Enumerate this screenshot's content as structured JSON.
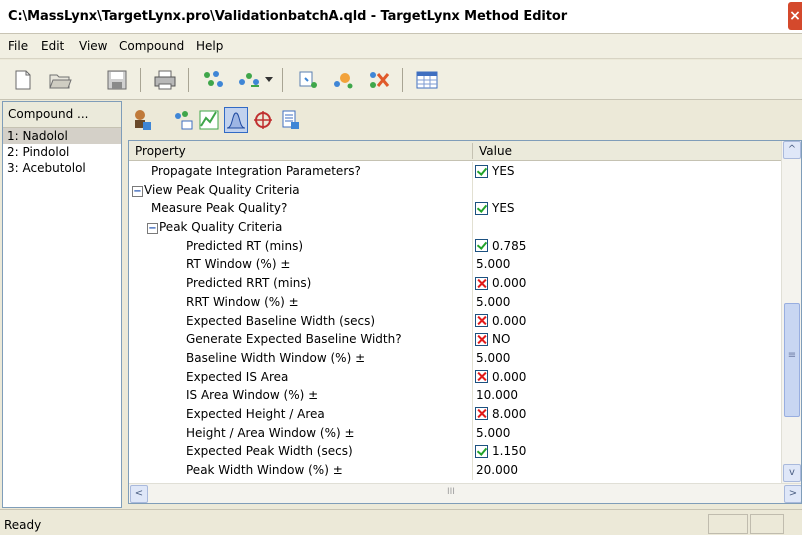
{
  "window": {
    "title": "C:\\MassLynx\\TargetLynx.pro\\ValidationbatchA.qld - TargetLynx Method Editor",
    "close_label": "×"
  },
  "menu": {
    "items": [
      "File",
      "Edit",
      "View",
      "Compound",
      "Help"
    ]
  },
  "toolbar": {
    "icons": [
      "new-file-icon",
      "open-folder-icon",
      "save-icon",
      "print-icon",
      "add-compound-icon",
      "insert-compound-icon",
      "dropdown-arrow-icon",
      "copy-compound-icon",
      "wizard-icon",
      "delete-compound-icon",
      "table-icon"
    ]
  },
  "compounds": {
    "header": "Compound ...",
    "items": [
      "1: Nadolol",
      "2: Pindolol",
      "3: Acebutolol"
    ]
  },
  "grid": {
    "col_property": "Property",
    "col_value": "Value",
    "rows": [
      {
        "label": "Propagate Integration Parameters?",
        "indent": 1,
        "check": "ok",
        "value": "YES"
      },
      {
        "label": "View Peak Quality Criteria",
        "indent": 0,
        "group": true,
        "expander": "−",
        "check": "",
        "value": ""
      },
      {
        "label": "Measure Peak Quality?",
        "indent": 1,
        "check": "ok",
        "value": "YES"
      },
      {
        "label": "Peak Quality Criteria",
        "indent": 1,
        "group": true,
        "expander": "−",
        "check": "",
        "value": ""
      },
      {
        "label": "Predicted RT (mins)",
        "indent": 2,
        "check": "ok",
        "value": "0.785"
      },
      {
        "label": "RT Window (%) ±",
        "indent": 2,
        "check": "",
        "value": "5.000"
      },
      {
        "label": "Predicted RRT (mins)",
        "indent": 2,
        "check": "x",
        "value": "0.000"
      },
      {
        "label": "RRT Window (%) ±",
        "indent": 2,
        "check": "",
        "value": "5.000"
      },
      {
        "label": "Expected Baseline Width (secs)",
        "indent": 2,
        "check": "x",
        "value": "0.000"
      },
      {
        "label": "Generate Expected Baseline Width?",
        "indent": 2,
        "check": "x",
        "value": "NO"
      },
      {
        "label": "Baseline Width Window (%) ±",
        "indent": 2,
        "check": "",
        "value": "5.000"
      },
      {
        "label": "Expected IS Area",
        "indent": 2,
        "check": "x",
        "value": "0.000"
      },
      {
        "label": "IS Area Window (%) ±",
        "indent": 2,
        "check": "",
        "value": "10.000"
      },
      {
        "label": "Expected Height / Area",
        "indent": 2,
        "check": "x",
        "value": "8.000"
      },
      {
        "label": "Height / Area Window (%) ±",
        "indent": 2,
        "check": "",
        "value": "5.000"
      },
      {
        "label": "Expected Peak Width (secs)",
        "indent": 2,
        "check": "ok",
        "value": "1.150"
      },
      {
        "label": "Peak Width Window (%) ±",
        "indent": 2,
        "check": "",
        "value": "20.000"
      }
    ]
  },
  "scroll": {
    "up": "^",
    "down": "v",
    "left": "<",
    "right": ">",
    "grip": "≡",
    "hgrip": "III"
  },
  "status": {
    "text": "Ready"
  }
}
